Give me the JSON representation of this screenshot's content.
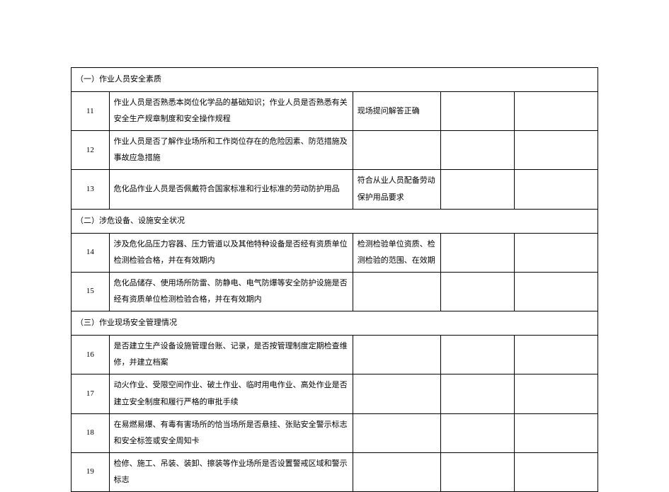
{
  "sections": [
    {
      "title": "（一）作业人员安全素质",
      "rows": [
        {
          "num": "11",
          "desc": "作业人员是否熟悉本岗位化学品的基础知识；作业人员是否熟悉有关安全生产规章制度和安全操作规程",
          "remark": "现场提问解答正确"
        },
        {
          "num": "12",
          "desc": "作业人员是否了解作业场所和工作岗位存在的危险因素、防范措施及事故应急措施",
          "remark": ""
        },
        {
          "num": "13",
          "desc": "危化品作业人员是否佩戴符合国家标准和行业标准的劳动防护用品",
          "remark": "符合从业人员配备劳动保护用品要求"
        }
      ]
    },
    {
      "title": "（二）涉危设备、设施安全状况",
      "rows": [
        {
          "num": "14",
          "desc": "涉及危化品压力容器、压力管道以及其他特种设备是否经有资质单位检测检验合格，并在有效期内",
          "remark": "检测检验单位资质、检测检验的范围、在效期"
        },
        {
          "num": "15",
          "desc": "危化品储存、使用场所防雷、防静电、电气防爆等安全防护设施是否经有资质单位检测检验合格，并在有效期内",
          "remark": ""
        }
      ]
    },
    {
      "title": "（三）作业现场安全管理情况",
      "rows": [
        {
          "num": "16",
          "desc": "是否建立生产设备设施管理台账、记录，是否按管理制度定期检查维修，并建立档案",
          "remark": ""
        },
        {
          "num": "17",
          "desc": "动火作业、受限空间作业、破土作业、临时用电作业、高处作业是否建立安全制度和履行严格的审批手续",
          "remark": ""
        },
        {
          "num": "18",
          "desc": "在易燃易爆、有毒有害场所的恰当场所是否悬挂、张贴安全警示标志和安全标签或安全周知卡",
          "remark": ""
        },
        {
          "num": "19",
          "desc": "检修、施工、吊装、装卸、擦装等作业场所是否设置警戒区域和警示标志",
          "remark": ""
        }
      ]
    }
  ]
}
